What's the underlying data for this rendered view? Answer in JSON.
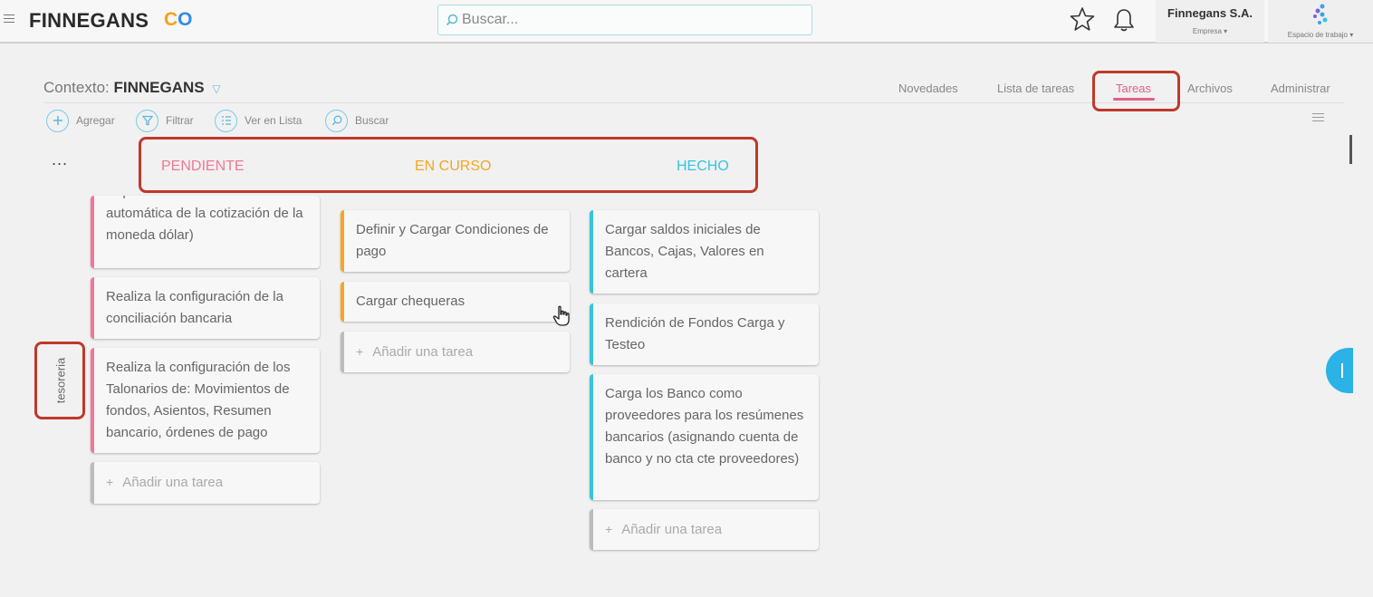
{
  "header": {
    "brand": "FINNEGANS",
    "brand_c": "C",
    "brand_o": "O",
    "search_placeholder": "Buscar...",
    "company_name": "Finnegans S.A.",
    "company_sub": "Empresa ▾",
    "workspace_sub": "Espacio de trabajo ▾"
  },
  "context": {
    "label": "Contexto:",
    "value": "FINNEGANS"
  },
  "nav": {
    "tabs": [
      "Novedades",
      "Lista de tareas",
      "Tareas",
      "Archivos",
      "Administrar"
    ],
    "active": "Tareas"
  },
  "toolbar": {
    "add": "Agregar",
    "filter": "Filtrar",
    "list_view": "Ver en Lista",
    "search": "Buscar"
  },
  "board": {
    "more": "...",
    "columns": [
      {
        "title": "PENDIENTE",
        "color": "#f07897"
      },
      {
        "title": "EN CURSO",
        "color": "#f5a623"
      },
      {
        "title": "HECHO",
        "color": "#36c5dd"
      }
    ],
    "lane": "tesoreria",
    "pendiente": [
      "requiere actualización automática de la cotización de la moneda dólar)",
      "Realiza la configuración de la conciliación bancaria",
      "Realiza la configuración de los Talonarios de: Movimientos de fondos, Asientos, Resumen bancario, órdenes de pago"
    ],
    "en_curso": [
      "Definir y Cargar Condiciones de pago",
      "Cargar chequeras"
    ],
    "hecho": [
      "Cargar saldos iniciales de Bancos, Cajas, Valores en cartera",
      "Rendición de Fondos Carga y Testeo",
      "Carga los Banco como proveedores para los resúmenes bancarios (asignando cuenta de banco y no cta cte proveedores)"
    ],
    "add_task": "Añadir una tarea"
  }
}
